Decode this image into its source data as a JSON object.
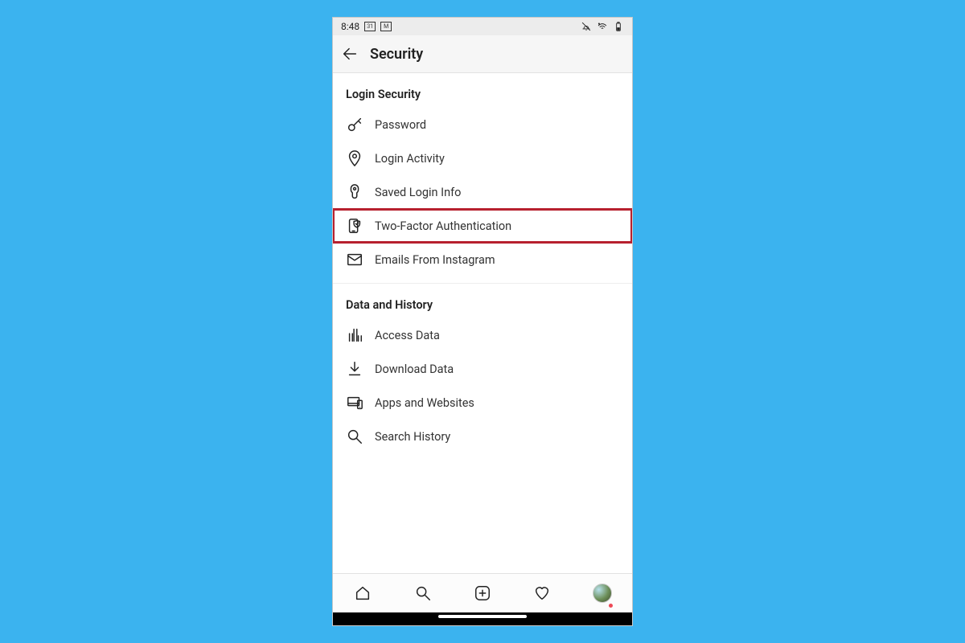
{
  "status": {
    "time": "8:48",
    "date_badge": "31",
    "mail_badge": "M"
  },
  "header": {
    "title": "Security"
  },
  "sections": [
    {
      "title": "Login Security",
      "items": [
        {
          "key": "password",
          "icon": "key-icon",
          "label": "Password"
        },
        {
          "key": "login-act",
          "icon": "pin-icon",
          "label": "Login Activity"
        },
        {
          "key": "saved-login",
          "icon": "keyhole-icon",
          "label": "Saved Login Info"
        },
        {
          "key": "two-factor",
          "icon": "phone-shield-icon",
          "label": "Two-Factor Authentication",
          "highlight": true
        },
        {
          "key": "emails",
          "icon": "mail-icon",
          "label": "Emails From Instagram"
        }
      ]
    },
    {
      "title": "Data and History",
      "items": [
        {
          "key": "access-data",
          "icon": "bar-chart-icon",
          "label": "Access Data"
        },
        {
          "key": "download",
          "icon": "download-icon",
          "label": "Download Data"
        },
        {
          "key": "apps-sites",
          "icon": "devices-icon",
          "label": "Apps and Websites"
        },
        {
          "key": "search-hist",
          "icon": "search-icon",
          "label": "Search History"
        }
      ]
    }
  ],
  "highlight_color": "#b7202e"
}
